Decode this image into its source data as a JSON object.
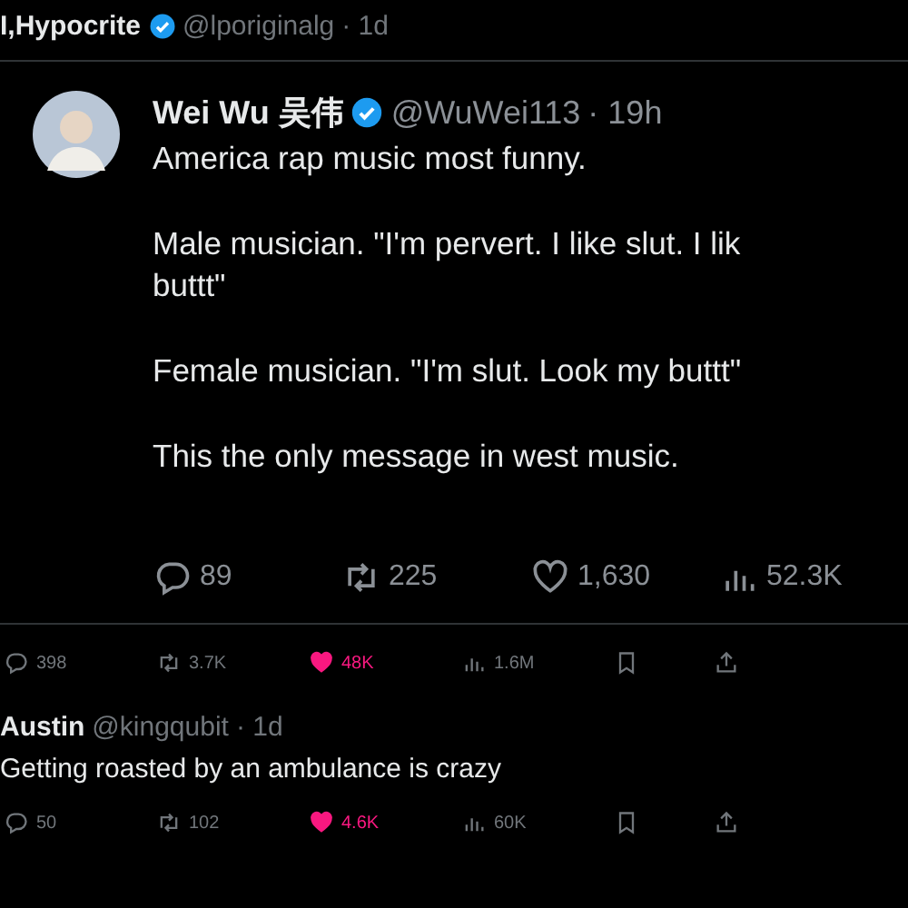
{
  "post": {
    "name": "I,Hypocrite",
    "verified": true,
    "handle": "@lporiginalg",
    "time": "· 1d"
  },
  "quoted": {
    "name": "Wei Wu 吴伟",
    "verified": true,
    "handle": "@WuWei113",
    "time": "· 19h",
    "paragraphs": [
      [
        "America rap music most funny."
      ],
      [
        "Male musician. \"I'm pervert. I like slut. I lik",
        "buttt\""
      ],
      [
        "Female musician. \"I'm slut. Look my buttt\""
      ],
      [
        "This the only message in west music."
      ]
    ],
    "stats": [
      {
        "kind": "reply",
        "count": "89"
      },
      {
        "kind": "retweet",
        "count": "225"
      },
      {
        "kind": "like",
        "count": "1,630",
        "liked": false
      },
      {
        "kind": "views",
        "count": "52.3K"
      }
    ]
  },
  "post_actions": [
    {
      "kind": "reply",
      "count": "398"
    },
    {
      "kind": "retweet",
      "count": "3.7K"
    },
    {
      "kind": "like",
      "count": "48K",
      "liked": true
    },
    {
      "kind": "views",
      "count": "1.6M"
    },
    {
      "kind": "bookmark"
    },
    {
      "kind": "share"
    }
  ],
  "reply": {
    "name": "Austin",
    "handle": "@kingqubit",
    "time": "· 1d",
    "text": "Getting roasted by an ambulance is crazy",
    "actions": [
      {
        "kind": "reply",
        "count": "50"
      },
      {
        "kind": "retweet",
        "count": "102"
      },
      {
        "kind": "like",
        "count": "4.6K",
        "liked": true
      },
      {
        "kind": "views",
        "count": "60K"
      },
      {
        "kind": "bookmark"
      },
      {
        "kind": "share"
      }
    ]
  }
}
